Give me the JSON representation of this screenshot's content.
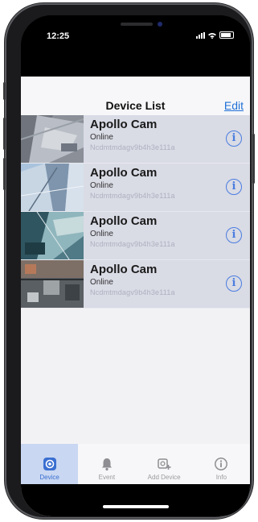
{
  "status_bar": {
    "time": "12:25"
  },
  "nav": {
    "title": "Device List",
    "edit_label": "Edit"
  },
  "devices": [
    {
      "name": "Apollo Cam",
      "status": "Online",
      "id": "Ncdmtmdagv9b4h3e111a",
      "thumbnail": "surveillance-thumbnail"
    },
    {
      "name": "Apollo Cam",
      "status": "Online",
      "id": "Ncdmtmdagv9b4h3e111a",
      "thumbnail": "surveillance-thumbnail"
    },
    {
      "name": "Apollo Cam",
      "status": "Online",
      "id": "Ncdmtmdagv9b4h3e111a",
      "thumbnail": "surveillance-thumbnail"
    },
    {
      "name": "Apollo Cam",
      "status": "Online",
      "id": "Ncdmtmdagv9b4h3e111a",
      "thumbnail": "surveillance-thumbnail"
    }
  ],
  "tabbar": {
    "items": [
      {
        "label": "Device",
        "icon": "camera-icon",
        "active": true
      },
      {
        "label": "Event",
        "icon": "bell-icon",
        "active": false
      },
      {
        "label": "Add Device",
        "icon": "add-device-icon",
        "active": false
      },
      {
        "label": "Info",
        "icon": "info-icon",
        "active": false
      }
    ]
  },
  "colors": {
    "accent": "#3b6fd1",
    "row_bg": "#d9dbe5",
    "active_tab_bg": "#c9d7f2"
  }
}
